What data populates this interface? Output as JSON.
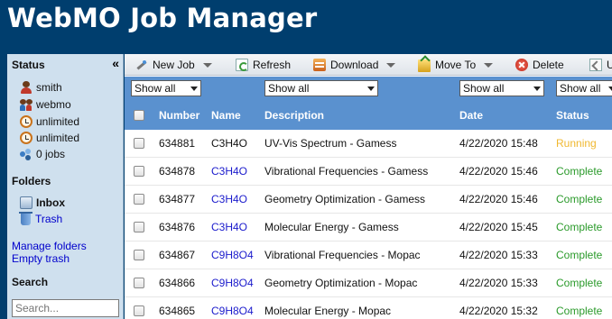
{
  "app": {
    "title": "WebMO Job Manager"
  },
  "colors": {
    "header_bg": "#003e6e",
    "table_header_bg": "#5a91cf",
    "sidebar_bg": "#cfe0ee",
    "running": "#f0b830",
    "complete": "#2a9a2a",
    "link": "#1a1acc"
  },
  "sidebar": {
    "collapse_label": "«",
    "status_heading": "Status",
    "status_items": [
      {
        "icon": "user-icon",
        "label": "smith"
      },
      {
        "icon": "group-icon",
        "label": "webmo"
      },
      {
        "icon": "clock-icon",
        "label": "unlimited"
      },
      {
        "icon": "clock-icon",
        "label": "unlimited"
      },
      {
        "icon": "jobs-icon",
        "label": "0 jobs"
      }
    ],
    "folders_heading": "Folders",
    "folders": [
      {
        "icon": "inbox-icon",
        "label": "Inbox"
      },
      {
        "icon": "trash-icon",
        "label": "Trash"
      }
    ],
    "manage_folders": "Manage folders",
    "empty_trash": "Empty trash",
    "search_heading": "Search",
    "search_placeholder": "Search..."
  },
  "toolbar": {
    "new_job": "New Job",
    "refresh": "Refresh",
    "download": "Download",
    "move_to": "Move To",
    "delete": "Delete",
    "undelete": "U"
  },
  "filters": {
    "name": "Show all",
    "description": "Show all",
    "date": "Show all",
    "status": "Show all"
  },
  "table": {
    "columns": {
      "number": "Number",
      "name": "Name",
      "description": "Description",
      "date": "Date",
      "status": "Status"
    },
    "rows": [
      {
        "number": "634881",
        "name": "C3H4O",
        "description": "UV-Vis Spectrum - Gamess",
        "date": "4/22/2020 15:48",
        "status": "Running"
      },
      {
        "number": "634878",
        "name": "C3H4O",
        "description": "Vibrational Frequencies - Gamess",
        "date": "4/22/2020 15:46",
        "status": "Complete"
      },
      {
        "number": "634877",
        "name": "C3H4O",
        "description": "Geometry Optimization - Gamess",
        "date": "4/22/2020 15:46",
        "status": "Complete"
      },
      {
        "number": "634876",
        "name": "C3H4O",
        "description": "Molecular Energy - Gamess",
        "date": "4/22/2020 15:45",
        "status": "Complete"
      },
      {
        "number": "634867",
        "name": "C9H8O4",
        "description": "Vibrational Frequencies - Mopac",
        "date": "4/22/2020 15:33",
        "status": "Complete"
      },
      {
        "number": "634866",
        "name": "C9H8O4",
        "description": "Geometry Optimization - Mopac",
        "date": "4/22/2020 15:33",
        "status": "Complete"
      },
      {
        "number": "634865",
        "name": "C9H8O4",
        "description": "Molecular Energy - Mopac",
        "date": "4/22/2020 15:32",
        "status": "Complete"
      }
    ]
  }
}
